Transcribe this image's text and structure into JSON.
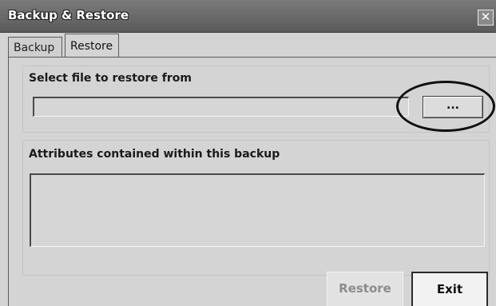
{
  "window": {
    "title": "Backup & Restore",
    "close_label": "✕"
  },
  "tabs": [
    {
      "label": "Backup",
      "active": false
    },
    {
      "label": "Restore",
      "active": true
    }
  ],
  "restore": {
    "select_label": "Select file to restore from",
    "file_value": "",
    "browse_label": "...",
    "attributes_label": "Attributes contained within this backup",
    "attributes_value": ""
  },
  "buttons": {
    "restore_label": "Restore",
    "restore_enabled": false,
    "exit_label": "Exit"
  }
}
